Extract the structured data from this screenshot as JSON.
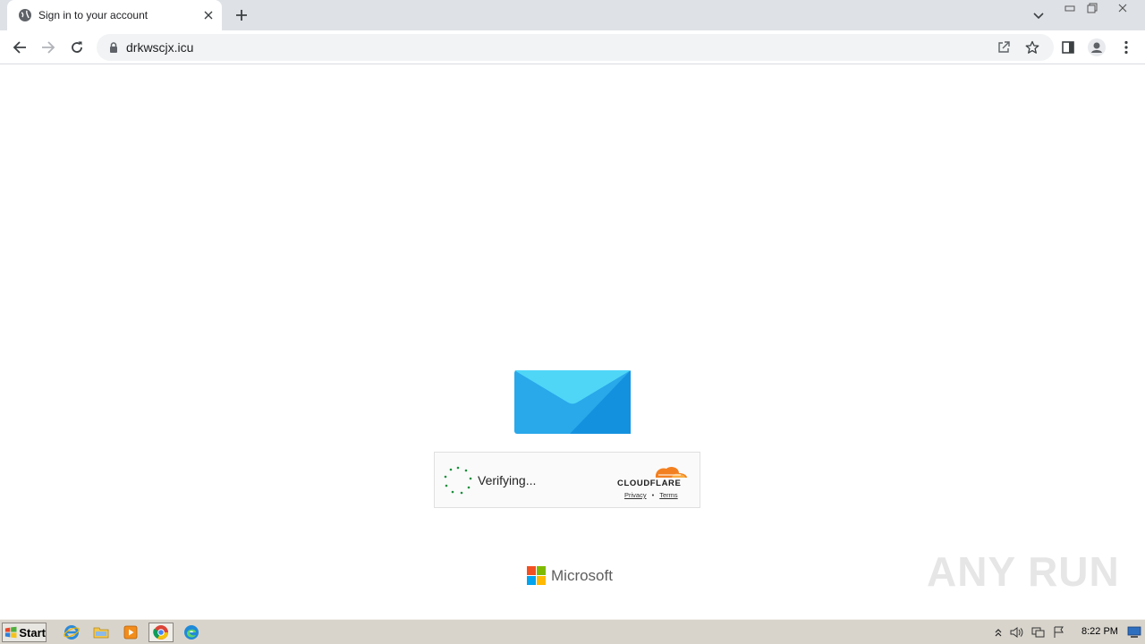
{
  "browser": {
    "tab": {
      "title": "Sign in to your account"
    },
    "address_bar": {
      "url": "drkwscjx.icu"
    }
  },
  "page": {
    "captcha": {
      "status": "Verifying...",
      "brand": "CLOUDFLARE",
      "privacy_link": "Privacy",
      "separator": "•",
      "terms_link": "Terms"
    },
    "footer_brand": "Microsoft"
  },
  "overlay": {
    "watermark": "ANY RUN"
  },
  "taskbar": {
    "start_label": "Start",
    "clock": "8:22 PM"
  },
  "colors": {
    "envelope_light": "#4fd6f7",
    "envelope_mid": "#29a8ea",
    "envelope_dark": "#1491de",
    "cloudflare_orange": "#f38020",
    "ms_red": "#f25022",
    "ms_green": "#7fba00",
    "ms_blue": "#00a4ef",
    "ms_yellow": "#ffb900"
  },
  "icons": {
    "tab_favicon": "globe-icon",
    "back": "arrow-left-icon",
    "forward": "arrow-right-icon",
    "reload": "reload-icon",
    "lock": "lock-icon",
    "share": "share-icon",
    "bookmark": "star-icon",
    "side_panel": "side-panel-icon",
    "profile": "profile-icon",
    "menu": "kebab-menu-icon"
  }
}
